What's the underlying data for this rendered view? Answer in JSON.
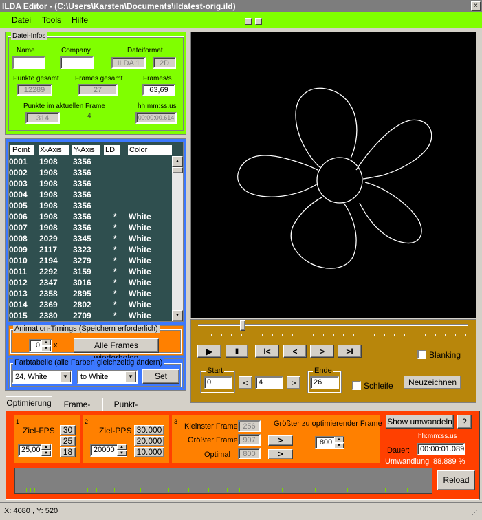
{
  "window": {
    "title": "ILDA Editor - (C:\\Users\\Karsten\\Documents\\ildatest-orig.ild)",
    "close_glyph": "×"
  },
  "menu": [
    "Datei",
    "Tools",
    "Hilfe"
  ],
  "datei_infos": {
    "label": "Datei-Infos",
    "name_label": "Name",
    "name_value": "",
    "company_label": "Company",
    "company_value": "",
    "format_label": "Dateiformat",
    "format_value": "ILDA 1",
    "format_dim": "2D",
    "punkte_gesamt_label": "Punkte gesamt",
    "punkte_gesamt": "12289",
    "frames_gesamt_label": "Frames gesamt",
    "frames_gesamt": "27",
    "fps_label": "Frames/s",
    "fps": "63,69",
    "punkte_frame_label": "Punkte im aktuellen Frame",
    "punkte_frame": "314",
    "frame_index": "4",
    "time_label": "hh:mm:ss.us",
    "time": "00:00:00.614"
  },
  "point_list": {
    "headers": [
      "Point",
      "X-Axis",
      "Y-Axis",
      "LD",
      "Color"
    ],
    "rows": [
      [
        "0001",
        "1908",
        "3356",
        "",
        ""
      ],
      [
        "0002",
        "1908",
        "3356",
        "",
        ""
      ],
      [
        "0003",
        "1908",
        "3356",
        "",
        ""
      ],
      [
        "0004",
        "1908",
        "3356",
        "",
        ""
      ],
      [
        "0005",
        "1908",
        "3356",
        "",
        ""
      ],
      [
        "0006",
        "1908",
        "3356",
        "*",
        "White"
      ],
      [
        "0007",
        "1908",
        "3356",
        "*",
        "White"
      ],
      [
        "0008",
        "2029",
        "3345",
        "*",
        "White"
      ],
      [
        "0009",
        "2117",
        "3323",
        "*",
        "White"
      ],
      [
        "0010",
        "2194",
        "3279",
        "*",
        "White"
      ],
      [
        "0011",
        "2292",
        "3159",
        "*",
        "White"
      ],
      [
        "0012",
        "2347",
        "3016",
        "*",
        "White"
      ],
      [
        "0013",
        "2358",
        "2895",
        "*",
        "White"
      ],
      [
        "0014",
        "2369",
        "2802",
        "*",
        "White"
      ],
      [
        "0015",
        "2380",
        "2709",
        "*",
        "White"
      ]
    ]
  },
  "animation": {
    "label": "Animation-Timings (Speichern erforderlich)",
    "repeat_value": "0",
    "x_label": "x",
    "repeat_button": "Alle Frames wiederholen"
  },
  "farbtabelle": {
    "label": "Farbtabelle (alle Farben gleichzeitig ändern)",
    "from_value": "24,  White",
    "to_value": "to  White",
    "set_button": "Set"
  },
  "player": {
    "start_label": "Start",
    "start_value": "0",
    "frame_value": "4",
    "ende_label": "Ende",
    "ende_value": "26",
    "blanking_label": "Blanking",
    "schleife_label": "Schleife",
    "redraw_button": "Neuzeichnen",
    "prev_glyph": "<",
    "next_glyph": ">",
    "play_glyph": "▶",
    "stop_glyph": "▮",
    "first_glyph": "I<",
    "back_glyph": "<",
    "fwd_glyph": ">",
    "last_glyph": ">I",
    "slider_fraction": 0.17
  },
  "tabs": [
    "Optimierung",
    "Frame-Editor",
    "Punkt-Editor"
  ],
  "optimierung": {
    "s1_num": "1",
    "zielfps_label": "Ziel-FPS",
    "zielfps_value": "25,00",
    "fps_presets": [
      "30",
      "25",
      "18"
    ],
    "s2_num": "2",
    "zielpps_label": "Ziel-PPS",
    "zielpps_value": "20000",
    "pps_presets": [
      "30.000",
      "20.000",
      "10.000"
    ],
    "s3_num": "3",
    "kleinster_label": "Kleinster Frame",
    "kleinster_value": "256",
    "groesster_label": "Größter Frame",
    "groesster_value": "907",
    "optimal_label": "Optimal",
    "optimal_value": "800",
    "max_label": "Größter zu optimierender Frame",
    "max_value": "800",
    "arrow_glyph": ">",
    "show_button": "Show umwandeln",
    "help_button": "?",
    "time_label": "hh:mm:ss.us",
    "dauer_label": "Dauer:",
    "dauer_value": "00:00:01.089",
    "umwandlung_label": "Umwandlung",
    "umwandlung_value": "88.889 %",
    "reload_button": "Reload"
  },
  "status": {
    "coords": "X:  4080 , Y:  520"
  },
  "colors": {
    "green": "#80ff00",
    "orange": "#ff8000",
    "list_bg": "#2f4f4f",
    "blue_panel": "#3c78ff",
    "player_bg": "#b8860b"
  }
}
